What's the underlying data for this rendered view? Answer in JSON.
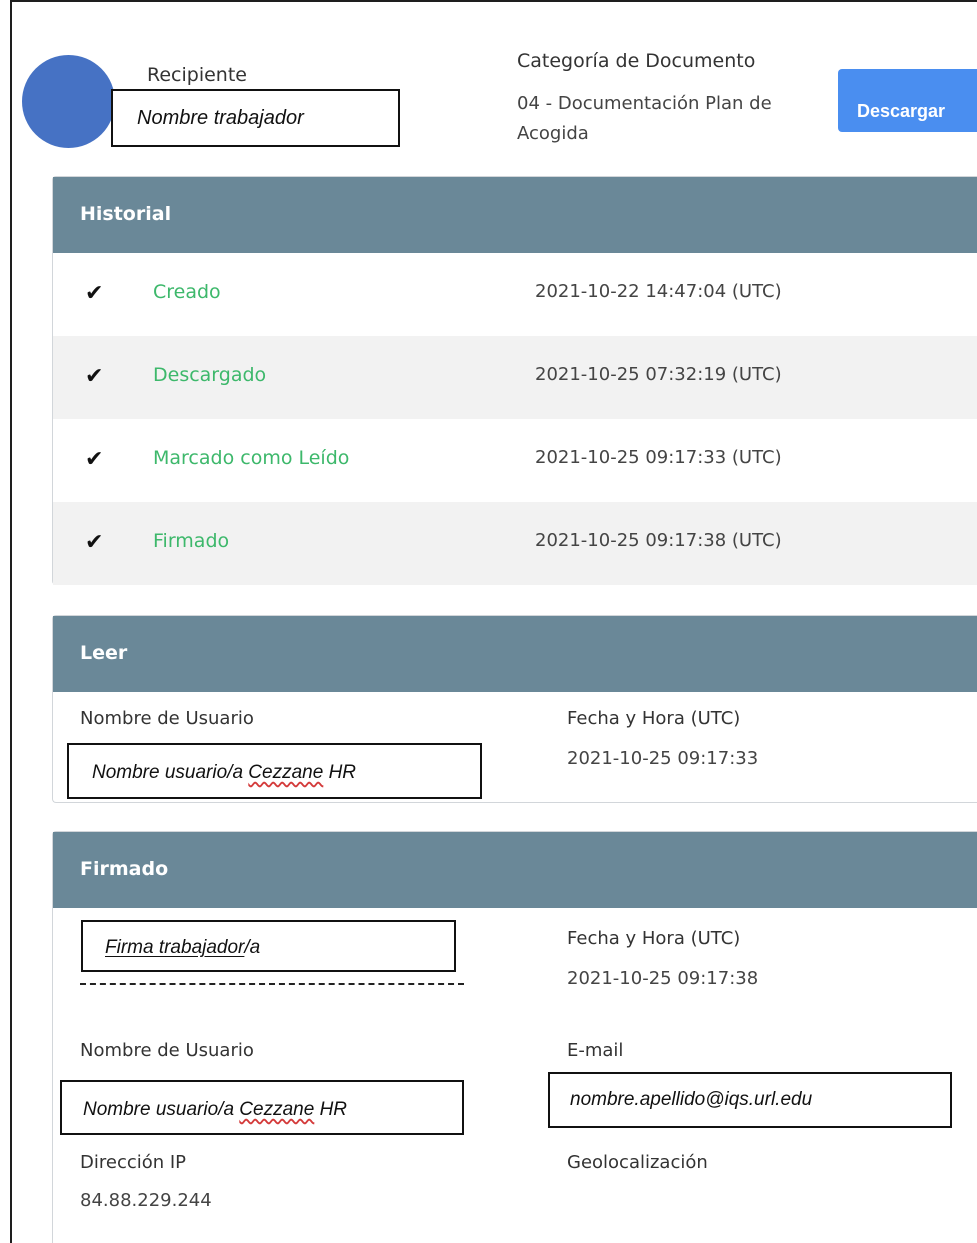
{
  "header": {
    "recipient_label": "Recipiente",
    "recipient_value": "Nombre trabajador",
    "category_label": "Categoría de Documento",
    "category_value": "04 - Documentación Plan de Acogida",
    "download_label": "Descargar"
  },
  "history": {
    "title": "Historial",
    "rows": [
      {
        "event": "Creado",
        "timestamp": "2021-10-22 14:47:04 (UTC)"
      },
      {
        "event": "Descargado",
        "timestamp": "2021-10-25 07:32:19 (UTC)"
      },
      {
        "event": "Marcado como Leído",
        "timestamp": "2021-10-25 09:17:33 (UTC)"
      },
      {
        "event": "Firmado",
        "timestamp": "2021-10-25 09:17:38 (UTC)"
      }
    ]
  },
  "read": {
    "title": "Leer",
    "username_label": "Nombre de Usuario",
    "username_value_prefix": "Nombre usuario/a ",
    "username_value_brand": "Cezzane",
    "username_value_suffix": " HR",
    "datetime_label": "Fecha y Hora (UTC)",
    "datetime_value": "2021-10-25 09:17:33"
  },
  "signed": {
    "title": "Firmado",
    "signature_value_main": "Firma trabajador",
    "signature_value_tail": "/a",
    "datetime_label": "Fecha y Hora (UTC)",
    "datetime_value": "2021-10-25 09:17:38",
    "username_label": "Nombre de Usuario",
    "username_value_prefix": "Nombre usuario/a ",
    "username_value_brand": "Cezzane",
    "username_value_suffix": " HR",
    "email_label": "E-mail",
    "email_value": "nombre.apellido@iqs.url.edu",
    "ip_label": "Dirección IP",
    "ip_value": "84.88.229.244",
    "geo_label": "Geolocalización"
  },
  "colors": {
    "header_bar": "#6a8898",
    "event_green": "#3db86b",
    "button_blue": "#4a8ef0",
    "avatar_blue": "#4672c4"
  }
}
